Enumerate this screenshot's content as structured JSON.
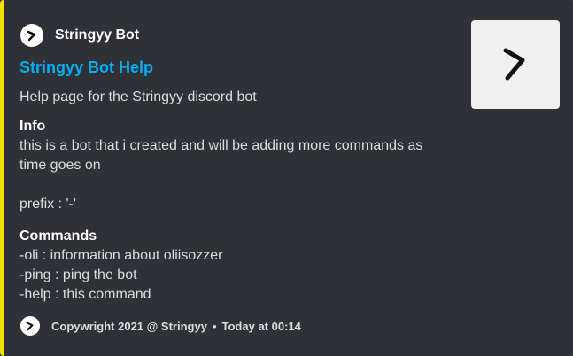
{
  "embed": {
    "accent_color": "#f2e200",
    "author": {
      "name": "Stringyy Bot",
      "icon": "stringyy-logo-icon"
    },
    "title": "Stringyy Bot Help",
    "title_color": "#00aff4",
    "description": "Help page for the Stringyy discord bot",
    "fields": [
      {
        "name": "Info",
        "lines": [
          "this is a bot that i created and will be adding more commands as",
          "time goes on",
          "",
          "prefix : '-'"
        ]
      },
      {
        "name": "Commands",
        "lines": [
          "-oli : information about oliisozzer",
          "-ping : ping the bot",
          "-help : this command"
        ]
      }
    ],
    "thumbnail": {
      "icon": "stringyy-logo-icon"
    },
    "footer": {
      "text": "Copywright 2021 @ Stringyy",
      "separator": "•",
      "timestamp": "Today at 00:14",
      "icon": "stringyy-logo-icon"
    }
  }
}
